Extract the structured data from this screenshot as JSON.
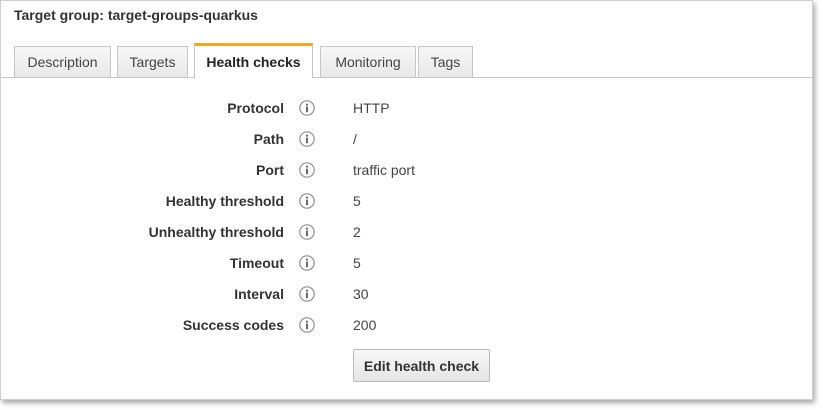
{
  "header": {
    "title": "Target group: target-groups-quarkus"
  },
  "tabs": [
    {
      "label": "Description",
      "active": false
    },
    {
      "label": "Targets",
      "active": false
    },
    {
      "label": "Health checks",
      "active": true
    },
    {
      "label": "Monitoring",
      "active": false
    },
    {
      "label": "Tags",
      "active": false
    }
  ],
  "health_checks": [
    {
      "label": "Protocol",
      "value": "HTTP",
      "icon": "info-icon"
    },
    {
      "label": "Path",
      "value": "/",
      "icon": "info-icon"
    },
    {
      "label": "Port",
      "value": "traffic port",
      "icon": "info-icon"
    },
    {
      "label": "Healthy threshold",
      "value": "5",
      "icon": "info-icon"
    },
    {
      "label": "Unhealthy threshold",
      "value": "2",
      "icon": "info-icon"
    },
    {
      "label": "Timeout",
      "value": "5",
      "icon": "info-icon"
    },
    {
      "label": "Interval",
      "value": "30",
      "icon": "info-icon"
    },
    {
      "label": "Success codes",
      "value": "200",
      "icon": "info-icon"
    }
  ],
  "actions": {
    "edit_label": "Edit health check"
  },
  "colors": {
    "active_tab_accent": "#f5a623"
  }
}
